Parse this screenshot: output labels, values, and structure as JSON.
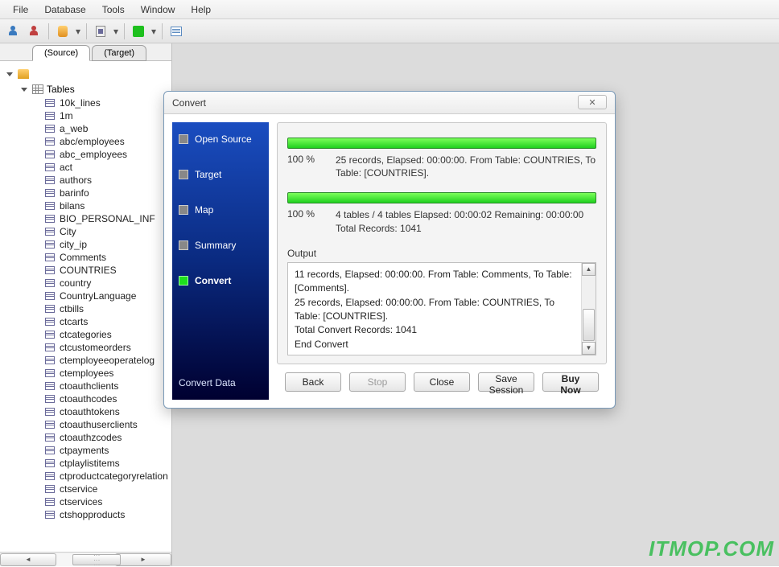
{
  "menubar": [
    "File",
    "Database",
    "Tools",
    "Window",
    "Help"
  ],
  "tabs": {
    "source": "(Source)",
    "target": "(Target)"
  },
  "tree": {
    "tablesLabel": "Tables",
    "tables": [
      "10k_lines",
      "1m",
      "a_web",
      "abc/employees",
      "abc_employees",
      "act",
      "authors",
      "barinfo",
      "bilans",
      "BIO_PERSONAL_INF",
      "City",
      "city_ip",
      "Comments",
      "COUNTRIES",
      "country",
      "CountryLanguage",
      "ctbills",
      "ctcarts",
      "ctcategories",
      "ctcustomeorders",
      "ctemployeeoperatelog",
      "ctemployees",
      "ctoauthclients",
      "ctoauthcodes",
      "ctoauthtokens",
      "ctoauthuserclients",
      "ctoauthzcodes",
      "ctpayments",
      "ctplaylistitems",
      "ctproductcategoryrelation",
      "ctservice",
      "ctservices",
      "ctshopproducts"
    ]
  },
  "dialog": {
    "title": "Convert",
    "wizard": {
      "steps": [
        "Open Source",
        "Target",
        "Map",
        "Summary",
        "Convert"
      ],
      "activeIndex": 4,
      "footer": "Convert Data"
    },
    "progress1": {
      "pct": "100 %",
      "info": "25 records,   Elapsed: 00:00:00.   From Table: COUNTRIES,  To Table: [COUNTRIES]."
    },
    "progress2": {
      "pct": "100 %",
      "info": "4 tables / 4 tables   Elapsed: 00:00:02   Remaining: 00:00:00  Total Records: 1041"
    },
    "outputLabel": "Output",
    "outputLines": [
      "11 records,   Elapsed: 00:00:00.   From Table: Comments,   To Table: [Comments].",
      "25 records,   Elapsed: 00:00:00.   From Table: COUNTRIES,   To Table: [COUNTRIES].",
      "Total Convert Records: 1041",
      "End Convert"
    ],
    "buttons": {
      "back": "Back",
      "stop": "Stop",
      "close": "Close",
      "save": "Save Session",
      "buy": "Buy Now"
    }
  },
  "watermark": "ITMOP.COM"
}
